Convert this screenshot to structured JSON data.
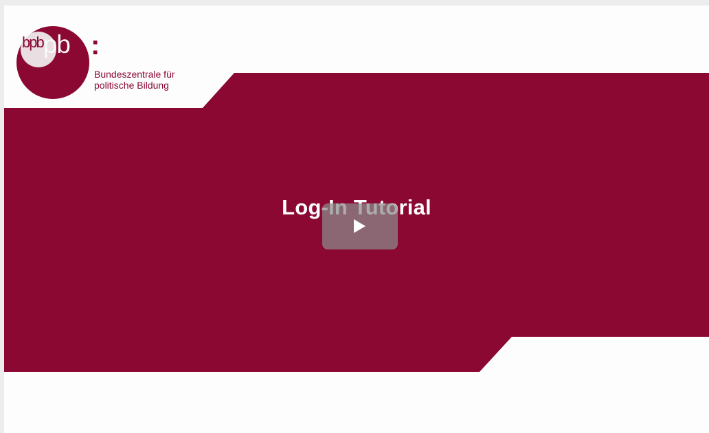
{
  "logo": {
    "mark_a": "bpb",
    "mark_b": "pb",
    "colon": ":",
    "line1": "Bundeszentrale für",
    "line2": "politische Bildung"
  },
  "video": {
    "title": "Log-In Tutorial",
    "play_icon": "play-icon"
  },
  "colors": {
    "brand": "#8a0832",
    "background": "#fdfdfd",
    "page_background": "#ededed",
    "play_button": "#8c8c8c"
  }
}
